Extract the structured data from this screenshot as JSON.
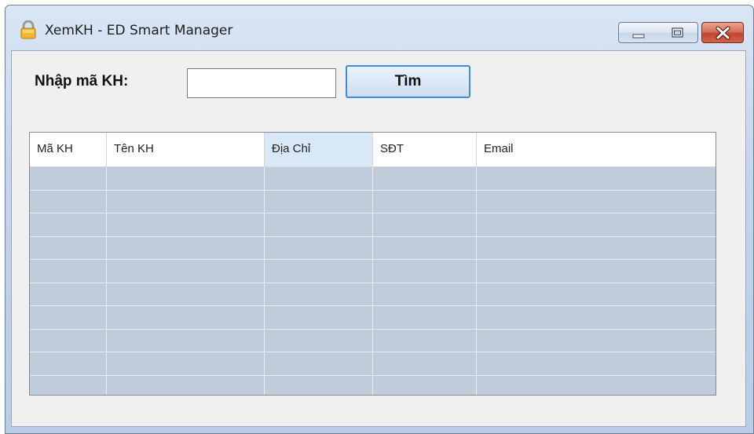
{
  "window": {
    "title": "XemKH - ED Smart Manager",
    "icon": "lock-icon"
  },
  "titlebar_buttons": {
    "minimize": "minimize-icon",
    "maximize": "maximize-icon",
    "close": "close-icon"
  },
  "form": {
    "ma_kh_label": "Nhập mã KH:",
    "ma_kh_value": "",
    "ma_kh_placeholder": "",
    "search_button": "Tìm"
  },
  "grid": {
    "columns": [
      "Mã KH",
      "Tên KH",
      "Địa Chỉ",
      "SĐT",
      "Email"
    ],
    "selected_column": "Địa Chỉ",
    "rows": [
      [
        "",
        "",
        "",
        "",
        ""
      ],
      [
        "",
        "",
        "",
        "",
        ""
      ],
      [
        "",
        "",
        "",
        "",
        ""
      ],
      [
        "",
        "",
        "",
        "",
        ""
      ],
      [
        "",
        "",
        "",
        "",
        ""
      ],
      [
        "",
        "",
        "",
        "",
        ""
      ],
      [
        "",
        "",
        "",
        "",
        ""
      ],
      [
        "",
        "",
        "",
        "",
        ""
      ],
      [
        "",
        "",
        "",
        "",
        ""
      ],
      [
        "",
        "",
        "",
        "",
        ""
      ]
    ]
  },
  "colors": {
    "accent": "#3c8fde",
    "grid_background": "#bfcddb",
    "header_selected": "#d8e8f6",
    "close_button": "#c5452d"
  }
}
